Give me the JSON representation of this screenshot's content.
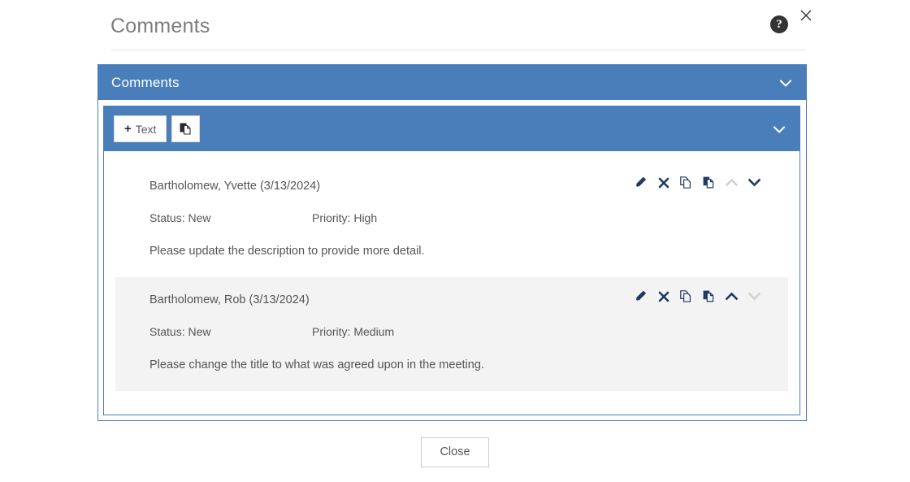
{
  "dialog": {
    "title": "Comments",
    "help_icon": "help-circle-icon",
    "close_icon": "close-icon"
  },
  "panel": {
    "title": "Comments",
    "collapse_icon": "chevron-down-icon"
  },
  "toolbar": {
    "add_text_label": "Text",
    "add_text_plus": "+",
    "paste_icon": "paste-icon",
    "collapse_icon": "chevron-down-icon"
  },
  "comments": [
    {
      "author": "Bartholomew, Yvette (3/13/2024)",
      "status": "Status: New",
      "priority": "Priority: High",
      "body": "Please update the description to provide more detail.",
      "highlighted": false,
      "move_up_enabled": false,
      "move_down_enabled": true
    },
    {
      "author": "Bartholomew, Rob (3/13/2024)",
      "status": "Status: New",
      "priority": "Priority: Medium",
      "body": "Please change the title to what was agreed upon in the meeting.",
      "highlighted": true,
      "move_up_enabled": true,
      "move_down_enabled": false
    }
  ],
  "row_actions": {
    "edit_icon": "pencil-icon",
    "delete_icon": "x-icon",
    "copy_icon": "copy-icon",
    "paste_icon": "paste-icon",
    "move_up_icon": "chevron-up-icon",
    "move_down_icon": "chevron-down-icon"
  },
  "footer": {
    "close_label": "Close"
  },
  "colors": {
    "panel_blue": "#4a7ebb",
    "icon_navy": "#1f3864",
    "icon_disabled": "#d2d2d2",
    "row_highlight": "#f3f3f3"
  }
}
